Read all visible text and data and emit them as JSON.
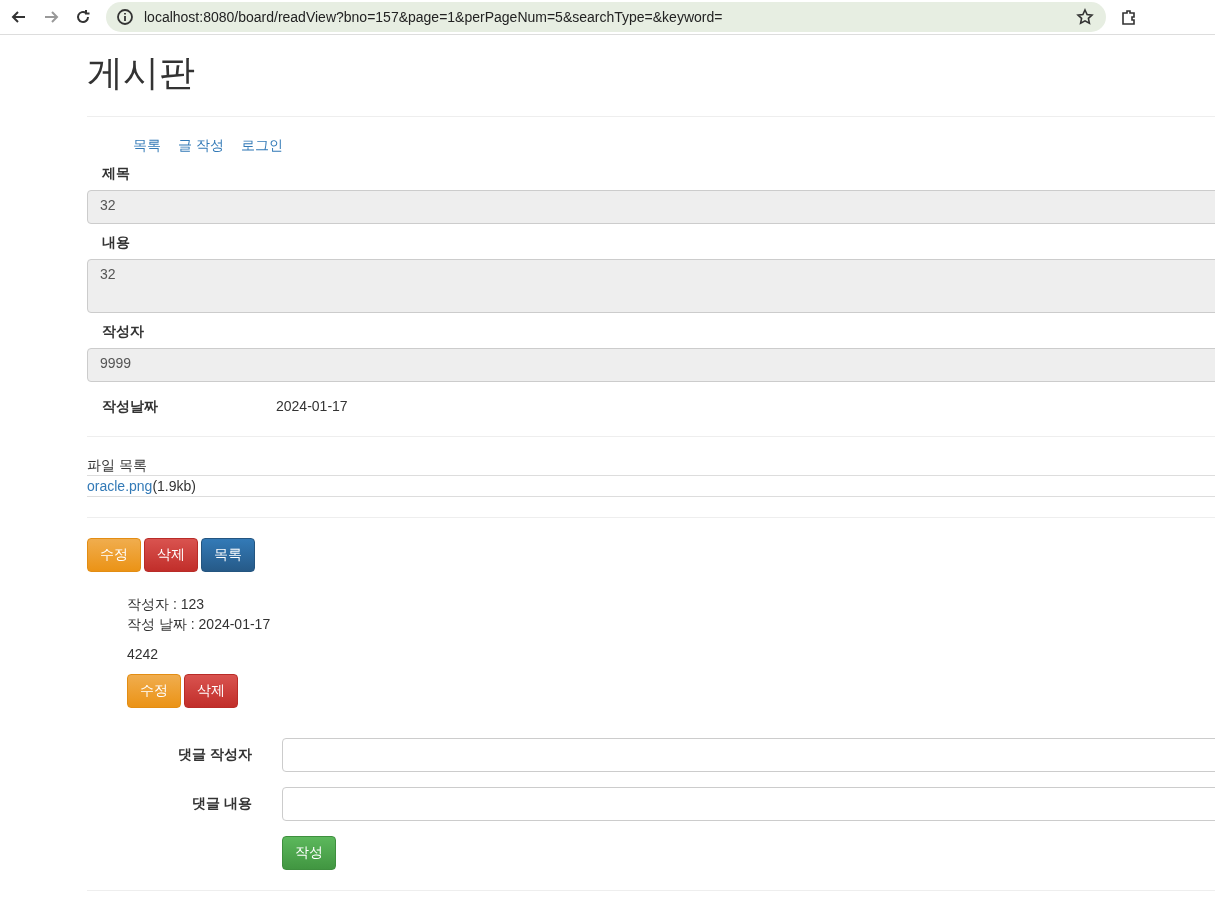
{
  "browser": {
    "url": "localhost:8080/board/readView?bno=157&page=1&perPageNum=5&searchType=&keyword="
  },
  "page_title": "게시판",
  "nav_links": [
    "목록",
    "글 작성",
    "로그인"
  ],
  "fields": [
    {
      "label": "제목",
      "value": "32",
      "kind": "input"
    },
    {
      "label": "내용",
      "value": "32",
      "kind": "textarea"
    },
    {
      "label": "작성자",
      "value": "9999",
      "kind": "input"
    }
  ],
  "date": {
    "label": "작성날짜",
    "value": "2024-01-17"
  },
  "files": {
    "label": "파일 목록",
    "items": [
      {
        "name": "oracle.png",
        "size": "(1.9kb)"
      }
    ]
  },
  "post_buttons": [
    {
      "label": "수정",
      "kind": "warning"
    },
    {
      "label": "삭제",
      "kind": "danger"
    },
    {
      "label": "목록",
      "kind": "primary"
    }
  ],
  "replies": [
    {
      "writer": "작성자 : 123",
      "date": "작성 날짜 : 2024-01-17",
      "content": "4242",
      "buttons": [
        {
          "label": "수정",
          "kind": "warning"
        },
        {
          "label": "삭제",
          "kind": "danger"
        }
      ]
    }
  ],
  "reply_form": {
    "fields": [
      {
        "label": "댓글 작성자"
      },
      {
        "label": "댓글 내용"
      }
    ],
    "submit": {
      "label": "작성",
      "kind": "success"
    }
  }
}
